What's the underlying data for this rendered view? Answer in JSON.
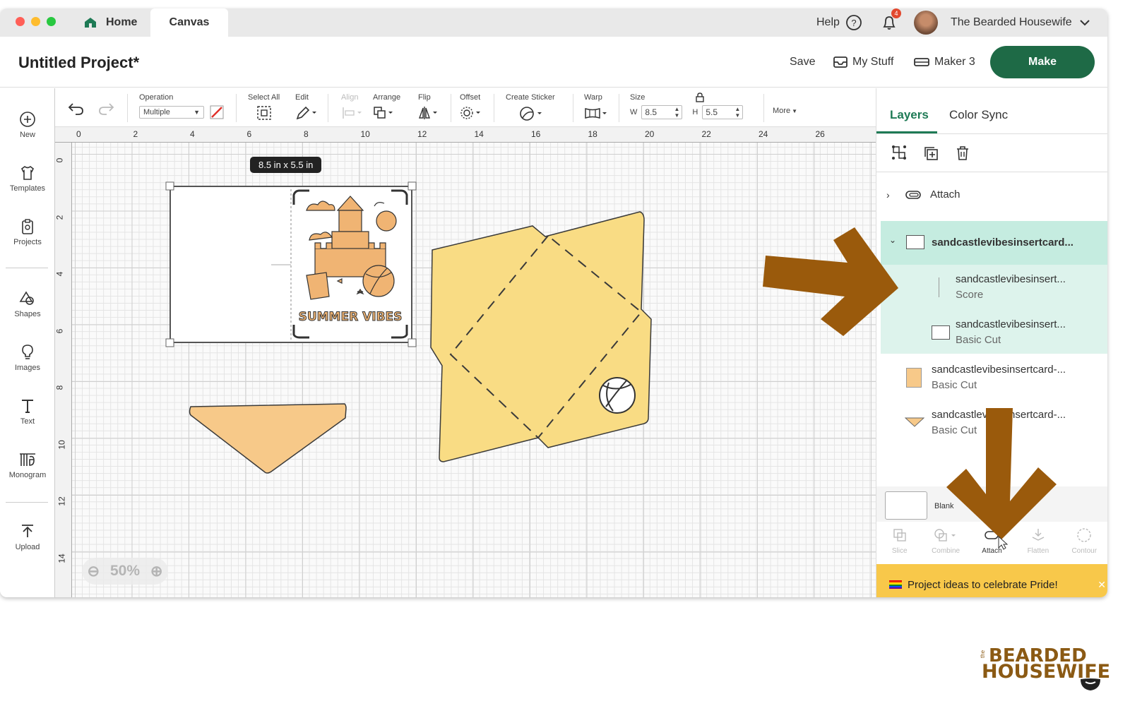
{
  "titlebar": {
    "tabs": [
      {
        "label": "Home"
      },
      {
        "label": "Canvas"
      }
    ],
    "help_label": "Help",
    "notification_count": "4",
    "user_name": "The Bearded Housewife",
    "traffic_colors": [
      "#ff5f57",
      "#febc2e",
      "#28c840"
    ]
  },
  "header": {
    "project_title": "Untitled Project*",
    "save_label": "Save",
    "mystuff_label": "My Stuff",
    "machine_label": "Maker 3",
    "make_label": "Make"
  },
  "sidebar": {
    "items": [
      {
        "label": "New",
        "icon": "plus-circle-icon"
      },
      {
        "label": "Templates",
        "icon": "shirt-icon"
      },
      {
        "label": "Projects",
        "icon": "clipboard-icon"
      },
      {
        "label": "Shapes",
        "icon": "shapes-icon"
      },
      {
        "label": "Images",
        "icon": "bulb-icon"
      },
      {
        "label": "Text",
        "icon": "text-icon"
      },
      {
        "label": "Monogram",
        "icon": "monogram-icon"
      },
      {
        "label": "Upload",
        "icon": "upload-icon"
      }
    ]
  },
  "toolbar": {
    "operation_label": "Operation",
    "operation_value": "Multiple",
    "select_all_label": "Select All",
    "edit_label": "Edit",
    "align_label": "Align",
    "arrange_label": "Arrange",
    "flip_label": "Flip",
    "offset_label": "Offset",
    "create_sticker_label": "Create Sticker",
    "warp_label": "Warp",
    "size_label": "Size",
    "w_label": "W",
    "w_value": "8.5",
    "h_label": "H",
    "h_value": "5.5",
    "more_label": "More"
  },
  "canvas": {
    "ruler_top": [
      "0",
      "2",
      "4",
      "6",
      "8",
      "10",
      "12",
      "14",
      "16",
      "18",
      "20",
      "22",
      "24",
      "26"
    ],
    "ruler_left": [
      "0",
      "2",
      "4",
      "6",
      "8",
      "10",
      "12",
      "14"
    ],
    "size_tooltip": "8.5  in x 5.5  in",
    "card_text": "SUMMER VIBES",
    "zoom_value": "50%",
    "colors": {
      "envelope": "#f9dc84",
      "flap": "#f7c989",
      "card_art": "#f0b473",
      "outline": "#3a3a3a"
    }
  },
  "layers_panel": {
    "tabs": [
      {
        "label": "Layers"
      },
      {
        "label": "Color Sync"
      }
    ],
    "attach_label": "Attach",
    "group_name": "sandcastlevibesinsertcard...",
    "children": [
      {
        "name": "sandcastlevibesinsert...",
        "op": "Score"
      },
      {
        "name": "sandcastlevibesinsert...",
        "op": "Basic Cut"
      }
    ],
    "layers": [
      {
        "name": "sandcastlevibesinsertcard-...",
        "op": "Basic Cut"
      },
      {
        "name": "sandcastlevibesinsertcard-...",
        "op": "Basic Cut"
      }
    ],
    "blank_label": "Blank",
    "tools": [
      {
        "label": "Slice"
      },
      {
        "label": "Combine"
      },
      {
        "label": "Attach"
      },
      {
        "label": "Flatten"
      },
      {
        "label": "Contour"
      }
    ],
    "promo_text": "Project ideas to celebrate Pride!",
    "highlight_color": "#c5ece0",
    "child_highlight_color": "#ddf3ec"
  },
  "watermark": {
    "line1": "BEARDED",
    "line2": "HOUSEWIFE",
    "prefix": "the"
  },
  "annotation_arrow_color": "#9a5a0c"
}
